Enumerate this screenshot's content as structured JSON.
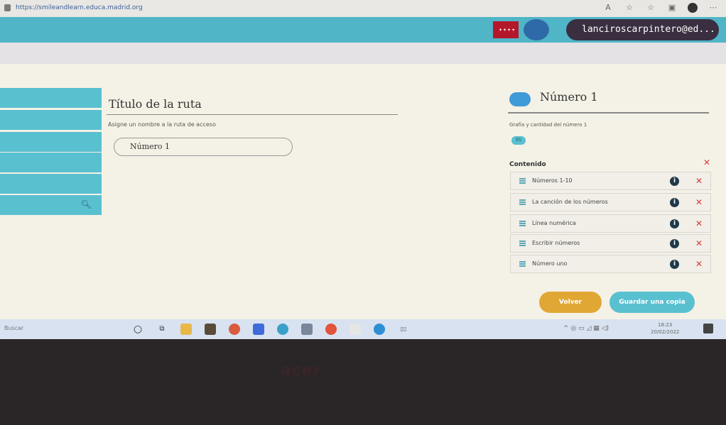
{
  "browser": {
    "url": "https://smileandlearn.educa.madrid.org"
  },
  "header": {
    "user": "lanciroscarpintero@ed... ▾"
  },
  "form": {
    "title": "Título de la ruta",
    "instruction": "Asigne un nombre a la ruta de acceso",
    "name_value": "Número 1"
  },
  "panel": {
    "title": "Número 1",
    "subtitle": "Grafía y cantidad del número 1",
    "tag": "ES",
    "content_label": "Contenido",
    "items": [
      {
        "label": "Números 1-10"
      },
      {
        "label": "La canción de los números"
      },
      {
        "label": "Línea numérica"
      },
      {
        "label": "Escribir números"
      },
      {
        "label": "Número uno"
      }
    ],
    "back_button": "Volver",
    "save_button": "Guardar una copia"
  },
  "taskbar": {
    "search": "Buscar",
    "time": "18:23",
    "date": "20/02/2022"
  },
  "bezel": {
    "brand": "acer"
  },
  "colors": {
    "accent": "#59c0d0",
    "topbar": "#4fb5c7",
    "back": "#e1a735",
    "remove": "#d43b3b"
  },
  "icons": [
    "lock-icon",
    "search-icon",
    "list-icon",
    "info-icon",
    "close-icon",
    "windows-search-icon",
    "task-view-icon",
    "notification-icon"
  ]
}
